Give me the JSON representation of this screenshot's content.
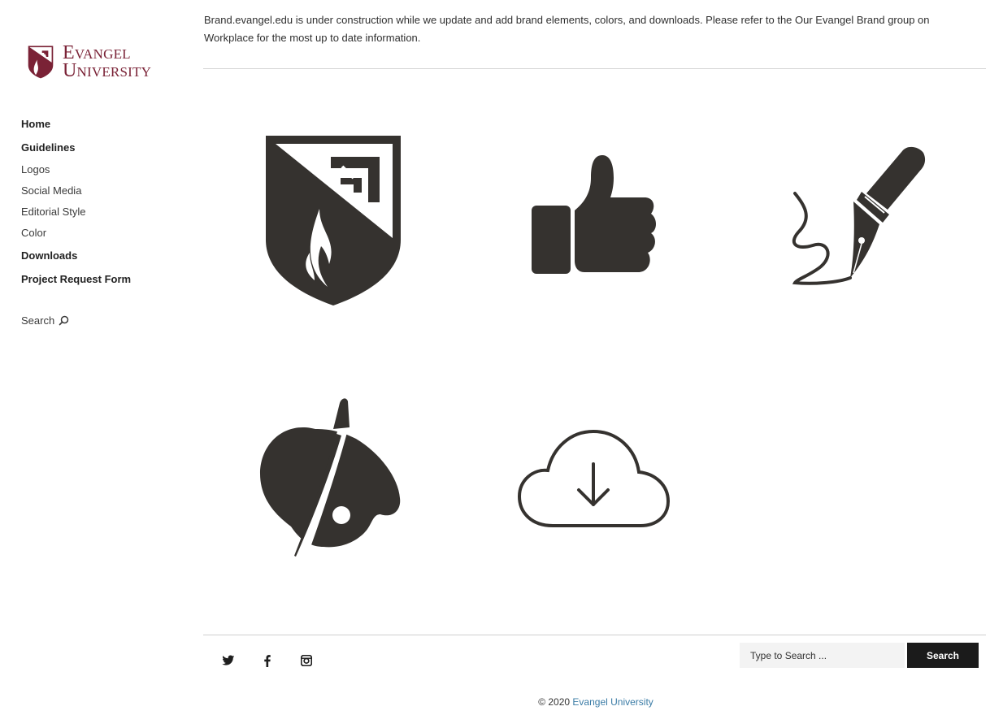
{
  "brand": {
    "line1": "Evangel",
    "line2": "University",
    "color": "#7a2236"
  },
  "nav": {
    "items": [
      {
        "label": "Home",
        "weight": "bold"
      },
      {
        "label": "Guidelines",
        "weight": "bold"
      },
      {
        "label": "Logos",
        "weight": "normal"
      },
      {
        "label": "Social Media",
        "weight": "normal"
      },
      {
        "label": "Editorial Style",
        "weight": "normal"
      },
      {
        "label": "Color",
        "weight": "normal"
      },
      {
        "label": "Downloads",
        "weight": "bold"
      },
      {
        "label": "Project Request Form",
        "weight": "bold"
      }
    ],
    "search_label": "Search"
  },
  "notice": "Brand.evangel.edu is under construction while we update and add brand elements, colors, and downloads. Please refer to the Our Evangel Brand group on Workplace for the most up to date information.",
  "tiles": [
    {
      "icon": "shield-logo-icon"
    },
    {
      "icon": "thumbs-up-icon"
    },
    {
      "icon": "fountain-pen-icon"
    },
    {
      "icon": "paint-palette-icon"
    },
    {
      "icon": "cloud-download-icon"
    }
  ],
  "icon_color": "#35322f",
  "footer": {
    "social": [
      "twitter-icon",
      "facebook-icon",
      "instagram-icon"
    ],
    "search_placeholder": "Type to Search ...",
    "search_button": "Search",
    "copyright_prefix": "© 2020 ",
    "copyright_link": "Evangel University",
    "link_color": "#3b7ca6"
  }
}
